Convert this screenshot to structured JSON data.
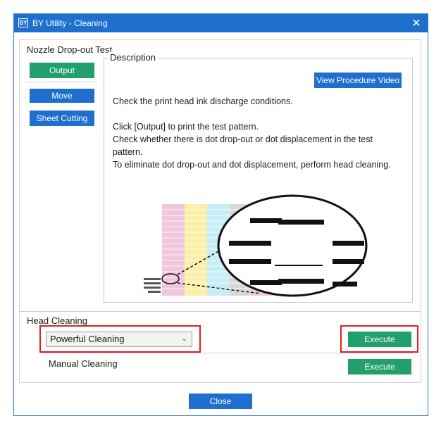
{
  "window": {
    "icon_label": "BY",
    "title": "BY Utility - Cleaning",
    "close_symbol": "✕"
  },
  "nozzle_test": {
    "section_title": "Nozzle Drop-out Test",
    "output_label": "Output",
    "move_label": "Move",
    "sheet_cutting_label": "Sheet Cutting"
  },
  "description": {
    "legend": "Description",
    "video_button_label": "View Procedure Video",
    "line1": "Check the print head ink discharge conditions.",
    "line2": "Click [Output] to print the test pattern.",
    "line3": "Check whether there is dot drop-out or dot displacement in the test pattern.",
    "line4": "To eliminate dot drop-out and dot displacement, perform head cleaning."
  },
  "head_cleaning": {
    "section_title": "Head Cleaning",
    "mode_selected": "Powerful Cleaning",
    "execute_label": "Execute",
    "manual_label": "Manual Cleaning",
    "manual_execute_label": "Execute"
  },
  "footer": {
    "close_label": "Close"
  },
  "colors": {
    "title_bar": "#1f6fce",
    "green_button": "#22a06b",
    "blue_button": "#1f6fce",
    "highlight": "#e02020"
  }
}
